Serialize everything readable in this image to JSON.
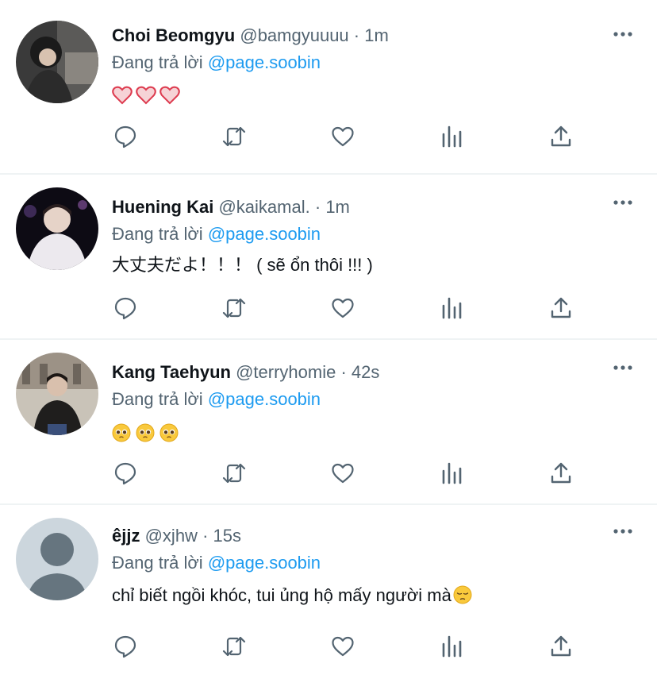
{
  "reply_prefix": "Đang trả lời",
  "tweets": [
    {
      "name": "Choi Beomgyu",
      "handle": "@bamgyuuuu",
      "time": "1m",
      "reply_to": "@page.soobin",
      "text": "",
      "emoji": [
        "heart",
        "heart",
        "heart"
      ]
    },
    {
      "name": "Huening Kai",
      "handle": "@kaikamal.",
      "time": "1m",
      "reply_to": "@page.soobin",
      "text": "大丈夫だよ！！！ ( sẽ ổn thôi !!! )",
      "emoji": []
    },
    {
      "name": "Kang Taehyun",
      "handle": "@terryhomie",
      "time": "42s",
      "reply_to": "@page.soobin",
      "text": "",
      "emoji": [
        "pleading-face",
        "pleading-face",
        "pleading-face"
      ]
    },
    {
      "name": "êjjz",
      "handle": "@xjhw",
      "time": "15s",
      "reply_to": "@page.soobin",
      "text": "chỉ biết ngồi khóc, tui ủng hộ mấy người mà",
      "emoji": [
        "pensive-face"
      ]
    }
  ],
  "action_icons": [
    "reply-icon",
    "retweet-icon",
    "like-icon",
    "analytics-icon",
    "share-icon"
  ],
  "colors": {
    "mention": "#1d9bf0",
    "secondary": "#536471",
    "divider": "#eff3f4",
    "icon": "#536471"
  }
}
